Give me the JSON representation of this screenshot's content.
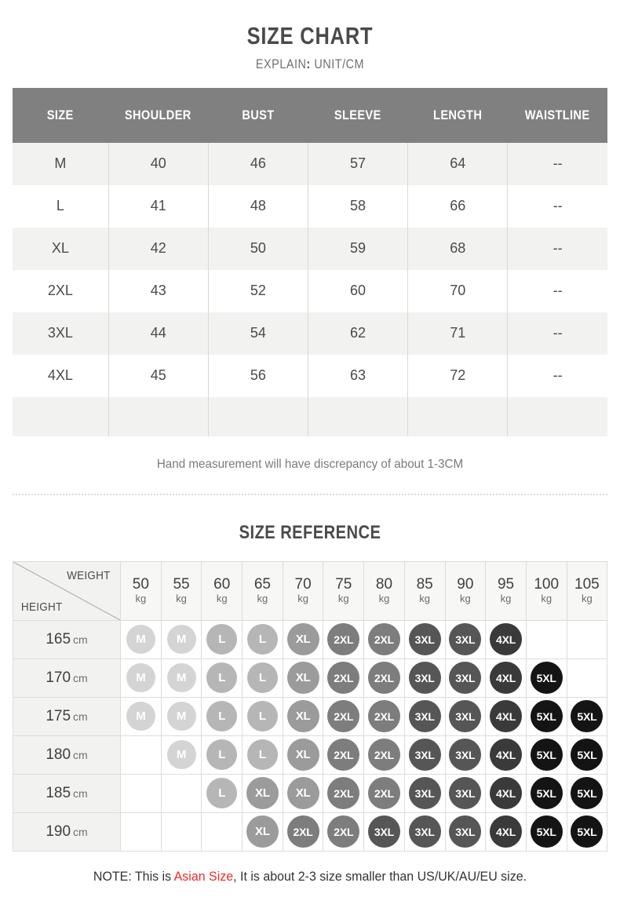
{
  "header": {
    "title": "SIZE CHART",
    "subtitle_label": "EXPLAIN",
    "subtitle_colon": ":",
    "subtitle_value": "UNIT/CM"
  },
  "size_chart": {
    "columns": [
      "SIZE",
      "SHOULDER",
      "BUST",
      "SLEEVE",
      "LENGTH",
      "WAISTLINE"
    ],
    "rows": [
      {
        "size": "M",
        "shoulder": "40",
        "bust": "46",
        "sleeve": "57",
        "length": "64",
        "waistline": "--"
      },
      {
        "size": "L",
        "shoulder": "41",
        "bust": "48",
        "sleeve": "58",
        "length": "66",
        "waistline": "--"
      },
      {
        "size": "XL",
        "shoulder": "42",
        "bust": "50",
        "sleeve": "59",
        "length": "68",
        "waistline": "--"
      },
      {
        "size": "2XL",
        "shoulder": "43",
        "bust": "52",
        "sleeve": "60",
        "length": "70",
        "waistline": "--"
      },
      {
        "size": "3XL",
        "shoulder": "44",
        "bust": "54",
        "sleeve": "62",
        "length": "71",
        "waistline": "--"
      },
      {
        "size": "4XL",
        "shoulder": "45",
        "bust": "56",
        "sleeve": "63",
        "length": "72",
        "waistline": "--"
      }
    ],
    "hand_note": "Hand measurement will have discrepancy of about 1-3CM"
  },
  "size_reference": {
    "title": "SIZE REFERENCE",
    "weight_label": "WEIGHT",
    "height_label": "HEIGHT",
    "weight_unit": "kg",
    "height_unit": "cm",
    "weights": [
      "50",
      "55",
      "60",
      "65",
      "70",
      "75",
      "80",
      "85",
      "90",
      "95",
      "100",
      "105"
    ],
    "heights": [
      "165",
      "170",
      "175",
      "180",
      "185",
      "190"
    ],
    "grid": [
      [
        "M",
        "M",
        "L",
        "L",
        "XL",
        "2XL",
        "2XL",
        "3XL",
        "3XL",
        "4XL",
        "",
        ""
      ],
      [
        "M",
        "M",
        "L",
        "L",
        "XL",
        "2XL",
        "2XL",
        "3XL",
        "3XL",
        "4XL",
        "5XL",
        ""
      ],
      [
        "M",
        "M",
        "L",
        "L",
        "XL",
        "2XL",
        "2XL",
        "3XL",
        "3XL",
        "4XL",
        "5XL",
        "5XL"
      ],
      [
        "",
        "M",
        "L",
        "L",
        "XL",
        "2XL",
        "2XL",
        "3XL",
        "3XL",
        "4XL",
        "5XL",
        "5XL"
      ],
      [
        "",
        "",
        "L",
        "XL",
        "XL",
        "2XL",
        "2XL",
        "3XL",
        "3XL",
        "4XL",
        "5XL",
        "5XL"
      ],
      [
        "",
        "",
        "",
        "XL",
        "2XL",
        "2XL",
        "3XL",
        "3XL",
        "3XL",
        "4XL",
        "5XL",
        "5XL"
      ]
    ]
  },
  "footer": {
    "note_prefix": "NOTE: This is ",
    "note_highlight": "Asian Size",
    "note_suffix": ", It is about 2-3 size smaller than US/UK/AU/EU size."
  },
  "colors": {
    "header_gray": "#808080",
    "row_alt": "#f2f2f0",
    "pill_M": "#d4d4d4",
    "pill_L": "#b6b6b6",
    "pill_XL": "#9b9b9b",
    "pill_2XL": "#7d7d7d",
    "pill_3XL": "#565656",
    "pill_4XL": "#3a3a3a",
    "pill_5XL": "#141414",
    "highlight_red": "#f02b2b"
  }
}
